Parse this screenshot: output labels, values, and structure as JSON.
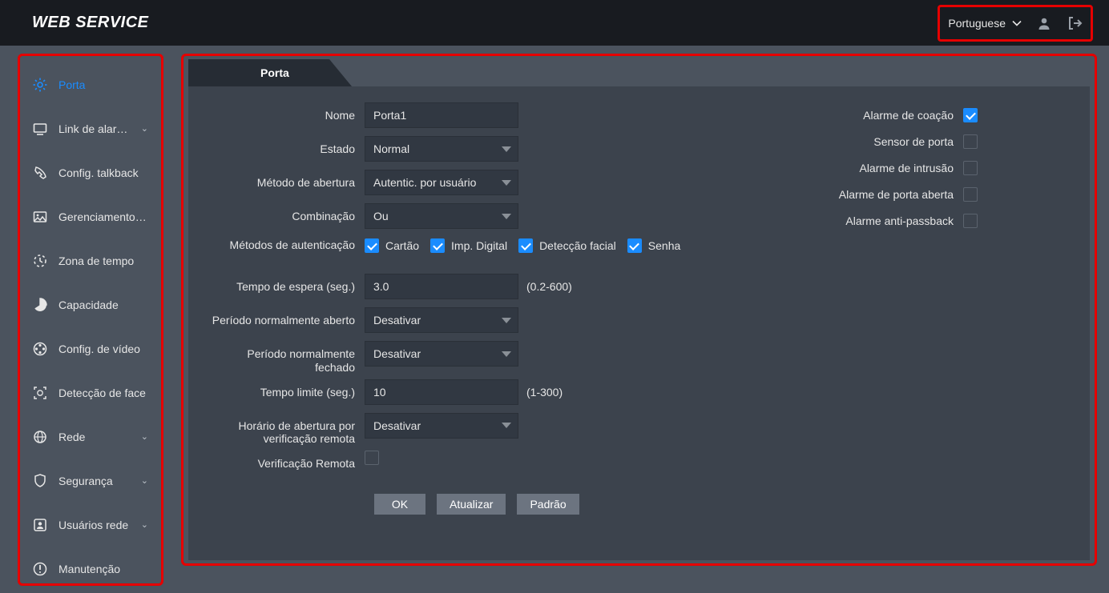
{
  "header": {
    "title": "WEB SERVICE",
    "language": "Portuguese"
  },
  "sidebar": {
    "items": [
      {
        "label": "Porta",
        "icon": "gear",
        "active": true
      },
      {
        "label": "Link de alarme",
        "icon": "monitor",
        "chevron": true
      },
      {
        "label": "Config. talkback",
        "icon": "phone"
      },
      {
        "label": "Gerenciamento de imagem",
        "icon": "image"
      },
      {
        "label": "Zona de tempo",
        "icon": "clock"
      },
      {
        "label": "Capacidade",
        "icon": "pie"
      },
      {
        "label": "Config. de vídeo",
        "icon": "reel"
      },
      {
        "label": "Detecção de face",
        "icon": "face"
      },
      {
        "label": "Rede",
        "icon": "globe",
        "chevron": true
      },
      {
        "label": "Segurança",
        "icon": "shield",
        "chevron": true
      },
      {
        "label": "Usuários rede",
        "icon": "user",
        "chevron": true
      },
      {
        "label": "Manutenção",
        "icon": "info"
      }
    ]
  },
  "tab": {
    "label": "Porta"
  },
  "form": {
    "labels": {
      "name": "Nome",
      "state": "Estado",
      "open_method": "Método de abertura",
      "combination": "Combinação",
      "auth_methods": "Métodos de autenticação",
      "wait_time": "Tempo de espera (seg.)",
      "normally_open": "Período normalmente aberto",
      "normally_closed": "Período normalmente fechado",
      "timeout": "Tempo limite (seg.)",
      "remote_open_time": "Horário de abertura por verificação remota",
      "remote_verify": "Verificação Remota"
    },
    "values": {
      "name": "Porta1",
      "state": "Normal",
      "open_method": "Autentic. por usuário",
      "combination": "Ou",
      "wait_time": "3.0",
      "wait_hint": "(0.2-600)",
      "normally_open": "Desativar",
      "normally_closed": "Desativar",
      "timeout": "10",
      "timeout_hint": "(1-300)",
      "remote_open_time": "Desativar"
    },
    "auth_options": {
      "card": "Cartão",
      "fingerprint": "Imp. Digital",
      "face": "Detecção facial",
      "password": "Senha"
    },
    "buttons": {
      "ok": "OK",
      "refresh": "Atualizar",
      "default": "Padrão"
    }
  },
  "alarms": {
    "coercion": "Alarme de coação",
    "door_sensor": "Sensor de porta",
    "intrusion": "Alarme de intrusão",
    "door_open": "Alarme de porta aberta",
    "anti_passback": "Alarme anti-passback"
  }
}
